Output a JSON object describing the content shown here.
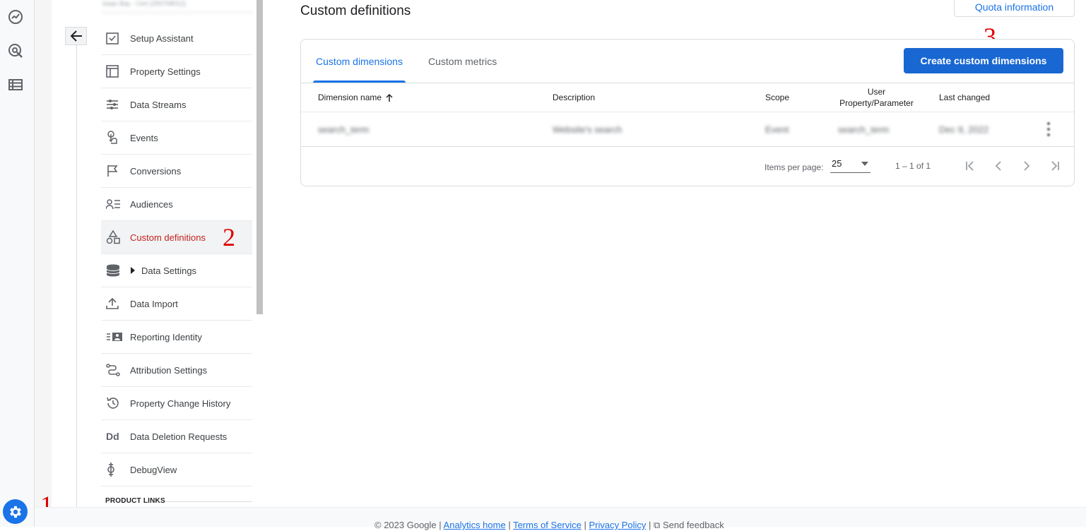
{
  "account": {
    "label": "Isaac Bay - Cert (290708012)"
  },
  "admin_nav": {
    "items": [
      {
        "label": "Setup Assistant",
        "icon": "checklist-icon"
      },
      {
        "label": "Property Settings",
        "icon": "property-window-icon"
      },
      {
        "label": "Data Streams",
        "icon": "data-streams-icon"
      },
      {
        "label": "Events",
        "icon": "touch-icon"
      },
      {
        "label": "Conversions",
        "icon": "flag-icon"
      },
      {
        "label": "Audiences",
        "icon": "audience-icon"
      },
      {
        "label": "Custom definitions",
        "icon": "shapes-icon",
        "active": true
      },
      {
        "label": "Data Settings",
        "icon": "database-icon",
        "expandable": true
      },
      {
        "label": "Data Import",
        "icon": "upload-icon"
      },
      {
        "label": "Reporting Identity",
        "icon": "identity-icon"
      },
      {
        "label": "Attribution Settings",
        "icon": "attribution-path-icon"
      },
      {
        "label": "Property Change History",
        "icon": "history-icon"
      },
      {
        "label": "Data Deletion Requests",
        "icon": "dd-icon"
      },
      {
        "label": "DebugView",
        "icon": "debug-icon"
      }
    ],
    "section_label": "PRODUCT LINKS"
  },
  "annotations": {
    "one": "1",
    "two": "2",
    "three": "3"
  },
  "main": {
    "title": "Custom definitions",
    "quota_button": "Quota information",
    "tabs": [
      {
        "label": "Custom dimensions",
        "active": true
      },
      {
        "label": "Custom metrics"
      }
    ],
    "create_button": "Create custom dimensions",
    "table": {
      "headers": [
        "Dimension name",
        "Description",
        "Scope",
        "User Property/Parameter",
        "Last changed"
      ],
      "user_prop_header_line1": "User",
      "user_prop_header_line2": "Property/Parameter",
      "rows": [
        {
          "name": "search_term",
          "description": "Website's search",
          "scope": "Event",
          "parameter": "search_term",
          "last_changed": "Dec 9, 2022"
        }
      ]
    },
    "pagination": {
      "items_per_page_label": "Items per page:",
      "items_per_page_value": "25",
      "range": "1 – 1 of 1"
    }
  },
  "footer": {
    "copyright": "© 2023 Google",
    "links": [
      "Analytics home",
      "Terms of Service",
      "Privacy Policy"
    ],
    "feedback": "Send feedback"
  },
  "colors": {
    "accent": "#1a73e8",
    "primary_button": "#1967d2",
    "active_nav": "#c5221f",
    "annotation": "#e00000"
  }
}
